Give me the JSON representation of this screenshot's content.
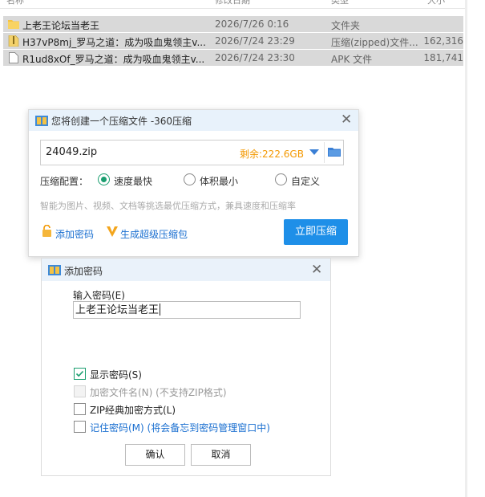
{
  "explorer": {
    "columns": {
      "name": "名称",
      "date": "修改日期",
      "type": "类型",
      "size": "大小"
    },
    "files": [
      {
        "name": "上老王论坛当老王",
        "date": "2026/7/26 0:16",
        "type": "文件夹",
        "size": "",
        "icon": "folder-icon"
      },
      {
        "name": "H37vP8mj_罗马之道：成为吸血鬼领主v...",
        "date": "2026/7/24 23:29",
        "type": "压缩(zipped)文件...",
        "size": "162,316",
        "icon": "zip-file-icon"
      },
      {
        "name": "R1ud8xOf_罗马之道：成为吸血鬼领主v...",
        "date": "2026/7/24 23:30",
        "type": "APK 文件",
        "size": "181,741",
        "icon": "file-icon"
      }
    ]
  },
  "compress_dialog": {
    "title": "您将创建一个压缩文件 -360压缩",
    "filename": "24049.zip",
    "free_space": "剩余:222.6GB",
    "config_label": "压缩配置：",
    "options": [
      {
        "label": "速度最快",
        "selected": true
      },
      {
        "label": "体积最小",
        "selected": false
      },
      {
        "label": "自定义",
        "selected": false
      }
    ],
    "hint": "智能为图片、视频、文档等挑选最优压缩方式，兼具速度和压缩率",
    "add_password": "添加密码",
    "super_package": "生成超级压缩包",
    "compress_now": "立即压缩",
    "accent": "#1e8fe8",
    "warning": "#f39800"
  },
  "password_dialog": {
    "title": "添加密码",
    "input_label": "输入密码(E)",
    "password_value": "上老王论坛当老王",
    "options": [
      {
        "label": "显示密码(S)",
        "checked": true,
        "disabled": false
      },
      {
        "label": "加密文件名(N) (不支持ZIP格式)",
        "checked": false,
        "disabled": true
      },
      {
        "label": "ZIP经典加密方式(L)",
        "checked": false,
        "disabled": false
      },
      {
        "label": "记住密码(M) (将会备忘到密码管理窗口中)",
        "checked": false,
        "disabled": false
      }
    ],
    "ok": "确认",
    "cancel": "取消"
  }
}
